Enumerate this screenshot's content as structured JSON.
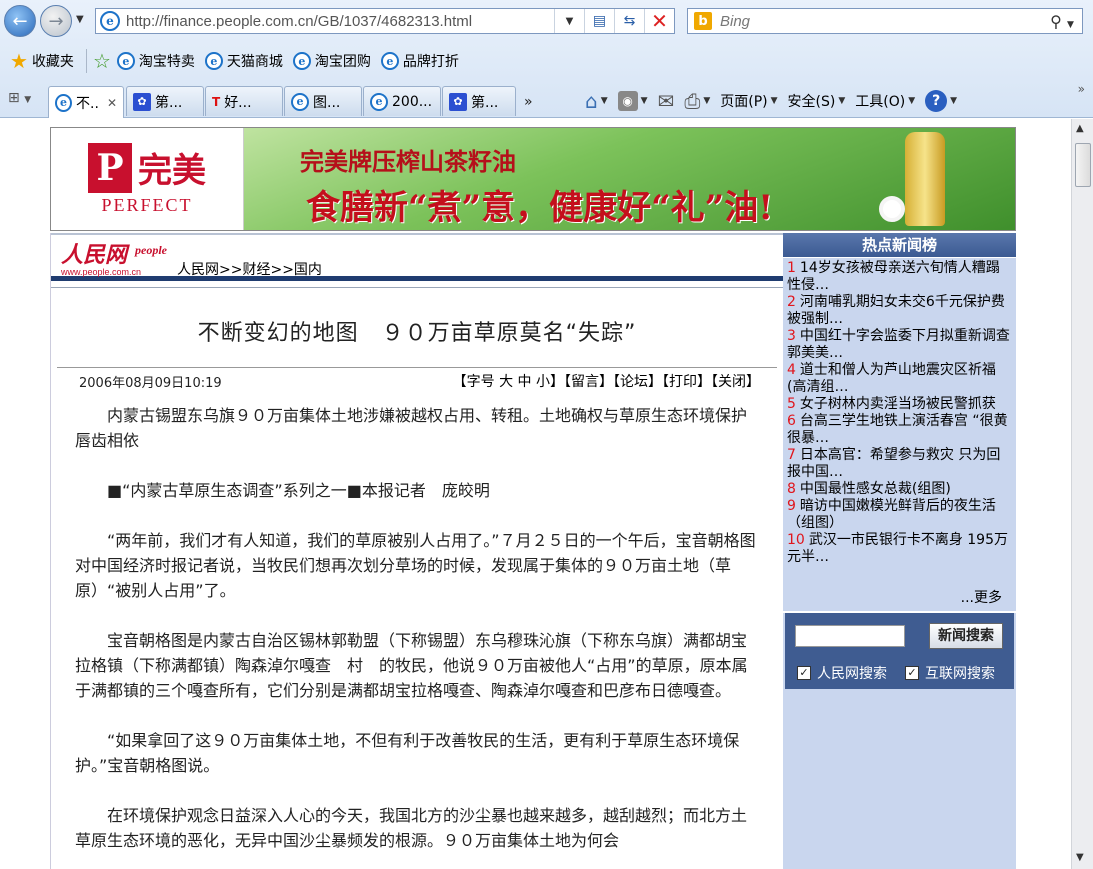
{
  "browser": {
    "url": "http://finance.people.com.cn/GB/1037/4682313.html",
    "search_placeholder": "Bing",
    "favorites": {
      "label": "收藏夹",
      "items": [
        "淘宝特卖",
        "天猫商城",
        "淘宝团购",
        "品牌打折"
      ]
    },
    "tabs": [
      {
        "label": "不..",
        "icon": "ie-icon",
        "active": true
      },
      {
        "label": "第...",
        "icon": "paw-icon"
      },
      {
        "label": "好...",
        "icon": "tmall-icon"
      },
      {
        "label": "图...",
        "icon": "ie-icon"
      },
      {
        "label": "200...",
        "icon": "ie-icon"
      },
      {
        "label": "第...",
        "icon": "paw-icon"
      }
    ],
    "tab_more": "»",
    "commands": {
      "page": "页面(P)",
      "safety": "安全(S)",
      "tools": "工具(O)"
    }
  },
  "ad": {
    "logo_cn": "完美",
    "logo_en": "PERFECT",
    "line1": "完美牌压榨山茶籽油",
    "line2": "食膳新“煮”意，健康好“礼”油!"
  },
  "site": {
    "logo_cn": "人民网",
    "logo_sub": "people",
    "logo_url": "www.people.com.cn",
    "breadcrumb": "人民网>>财经>>国内"
  },
  "article": {
    "title": "不断变幻的地图　９０万亩草原莫名“失踪”",
    "date": "2006年08月09日10:19",
    "tools": "【字号 大 中 小】【留言】【论坛】【打印】【关闭】",
    "paragraphs": [
      "内蒙古锡盟东乌旗９０万亩集体土地涉嫌被越权占用、转租。土地确权与草原生态环境保护唇齿相依",
      "■“内蒙古草原生态调查”系列之一■本报记者　庞皎明",
      "“两年前，我们才有人知道，我们的草原被别人占用了。”７月２５日的一个午后，宝音朝格图对中国经济时报记者说，当牧民们想再次划分草场的时候，发现属于集体的９０万亩土地（草原）“被别人占用”了。",
      "宝音朝格图是内蒙古自治区锡林郭勒盟（下称锡盟）东乌穆珠沁旗（下称东乌旗）满都胡宝拉格镇（下称满都镇）陶森淖尔嘎查　村　的牧民，他说９０万亩被他人“占用”的草原，原本属于满都镇的三个嘎查所有，它们分别是满都胡宝拉格嘎查、陶森淖尔嘎查和巴彦布日德嘎查。",
      "“如果拿回了这９０万亩集体土地，不但有利于改善牧民的生活，更有利于草原生态环境保护。”宝音朝格图说。",
      "在环境保护观念日益深入人心的今天，我国北方的沙尘暴也越来越多，越刮越烈；而北方土草原生态环境的恶化，无异中国沙尘暴频发的根源。９０万亩集体土地为何会"
    ]
  },
  "sidebar": {
    "hot_title": "热点新闻榜",
    "hot_items": [
      {
        "num": "1",
        "text": "14岁女孩被母亲送六旬情人糟蹋 性侵…"
      },
      {
        "num": "2",
        "text": "河南哺乳期妇女未交6千元保护费被强制…"
      },
      {
        "num": "3",
        "text": "中国红十字会监委下月拟重新调查郭美美…"
      },
      {
        "num": "4",
        "text": "道士和僧人为芦山地震灾区祈福(高清组…"
      },
      {
        "num": "5",
        "text": "女子树林内卖淫当场被民警抓获"
      },
      {
        "num": "6",
        "text": "台高三学生地铁上演活春宫 “很黄很暴…"
      },
      {
        "num": "7",
        "text": "日本高官：希望参与救灾 只为回报中国…"
      },
      {
        "num": "8",
        "text": "中国最性感女总裁(组图)"
      },
      {
        "num": "9",
        "text": "暗访中国嫩模光鲜背后的夜生活（组图）"
      },
      {
        "num": "10",
        "text": "武汉一市民银行卡不离身 195万元半…"
      }
    ],
    "more": "...更多",
    "search_button": "新闻搜索",
    "check_people": "人民网搜索",
    "check_web": "互联网搜索"
  }
}
